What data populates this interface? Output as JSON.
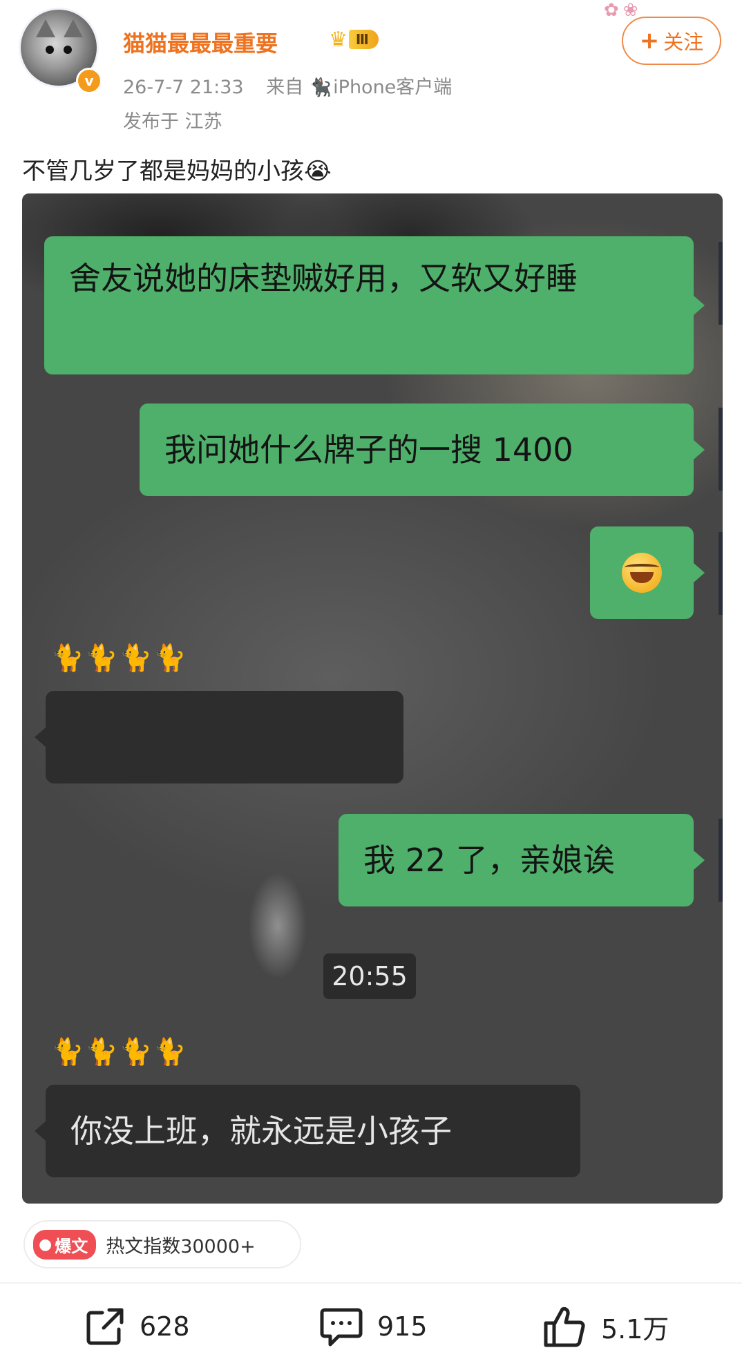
{
  "header": {
    "username": "猫猫最最最重要",
    "level_badge": "Ⅲ",
    "timestamp": "26-7-7 21:33",
    "source_prefix": "来自",
    "source": "iPhone客户端",
    "location": "发布于 江苏",
    "follow_label": "关注"
  },
  "post": {
    "text": "不管几岁了都是妈妈的小孩😭"
  },
  "chat": {
    "msg1": "舍友说她的床垫贼好用，又软又好睡",
    "msg2": "我问她什么牌子的一搜 1400",
    "sender1": "🐈🐈🐈🐈",
    "msg4": "",
    "msg5": "我 22 了，亲娘诶",
    "time": "20:55",
    "sender2": "🐈🐈🐈🐈",
    "msg6": "你没上班，就永远是小孩子"
  },
  "hot": {
    "badge": "爆文",
    "text": "热文指数30000+"
  },
  "actions": {
    "share_count": "628",
    "comment_count": "915",
    "like_count": "5.1万"
  },
  "colors": {
    "username": "#ee7320",
    "bubble_green": "#4eb06a",
    "bubble_dark": "#2d2d2d",
    "hot_badge": "#ef4e54"
  }
}
